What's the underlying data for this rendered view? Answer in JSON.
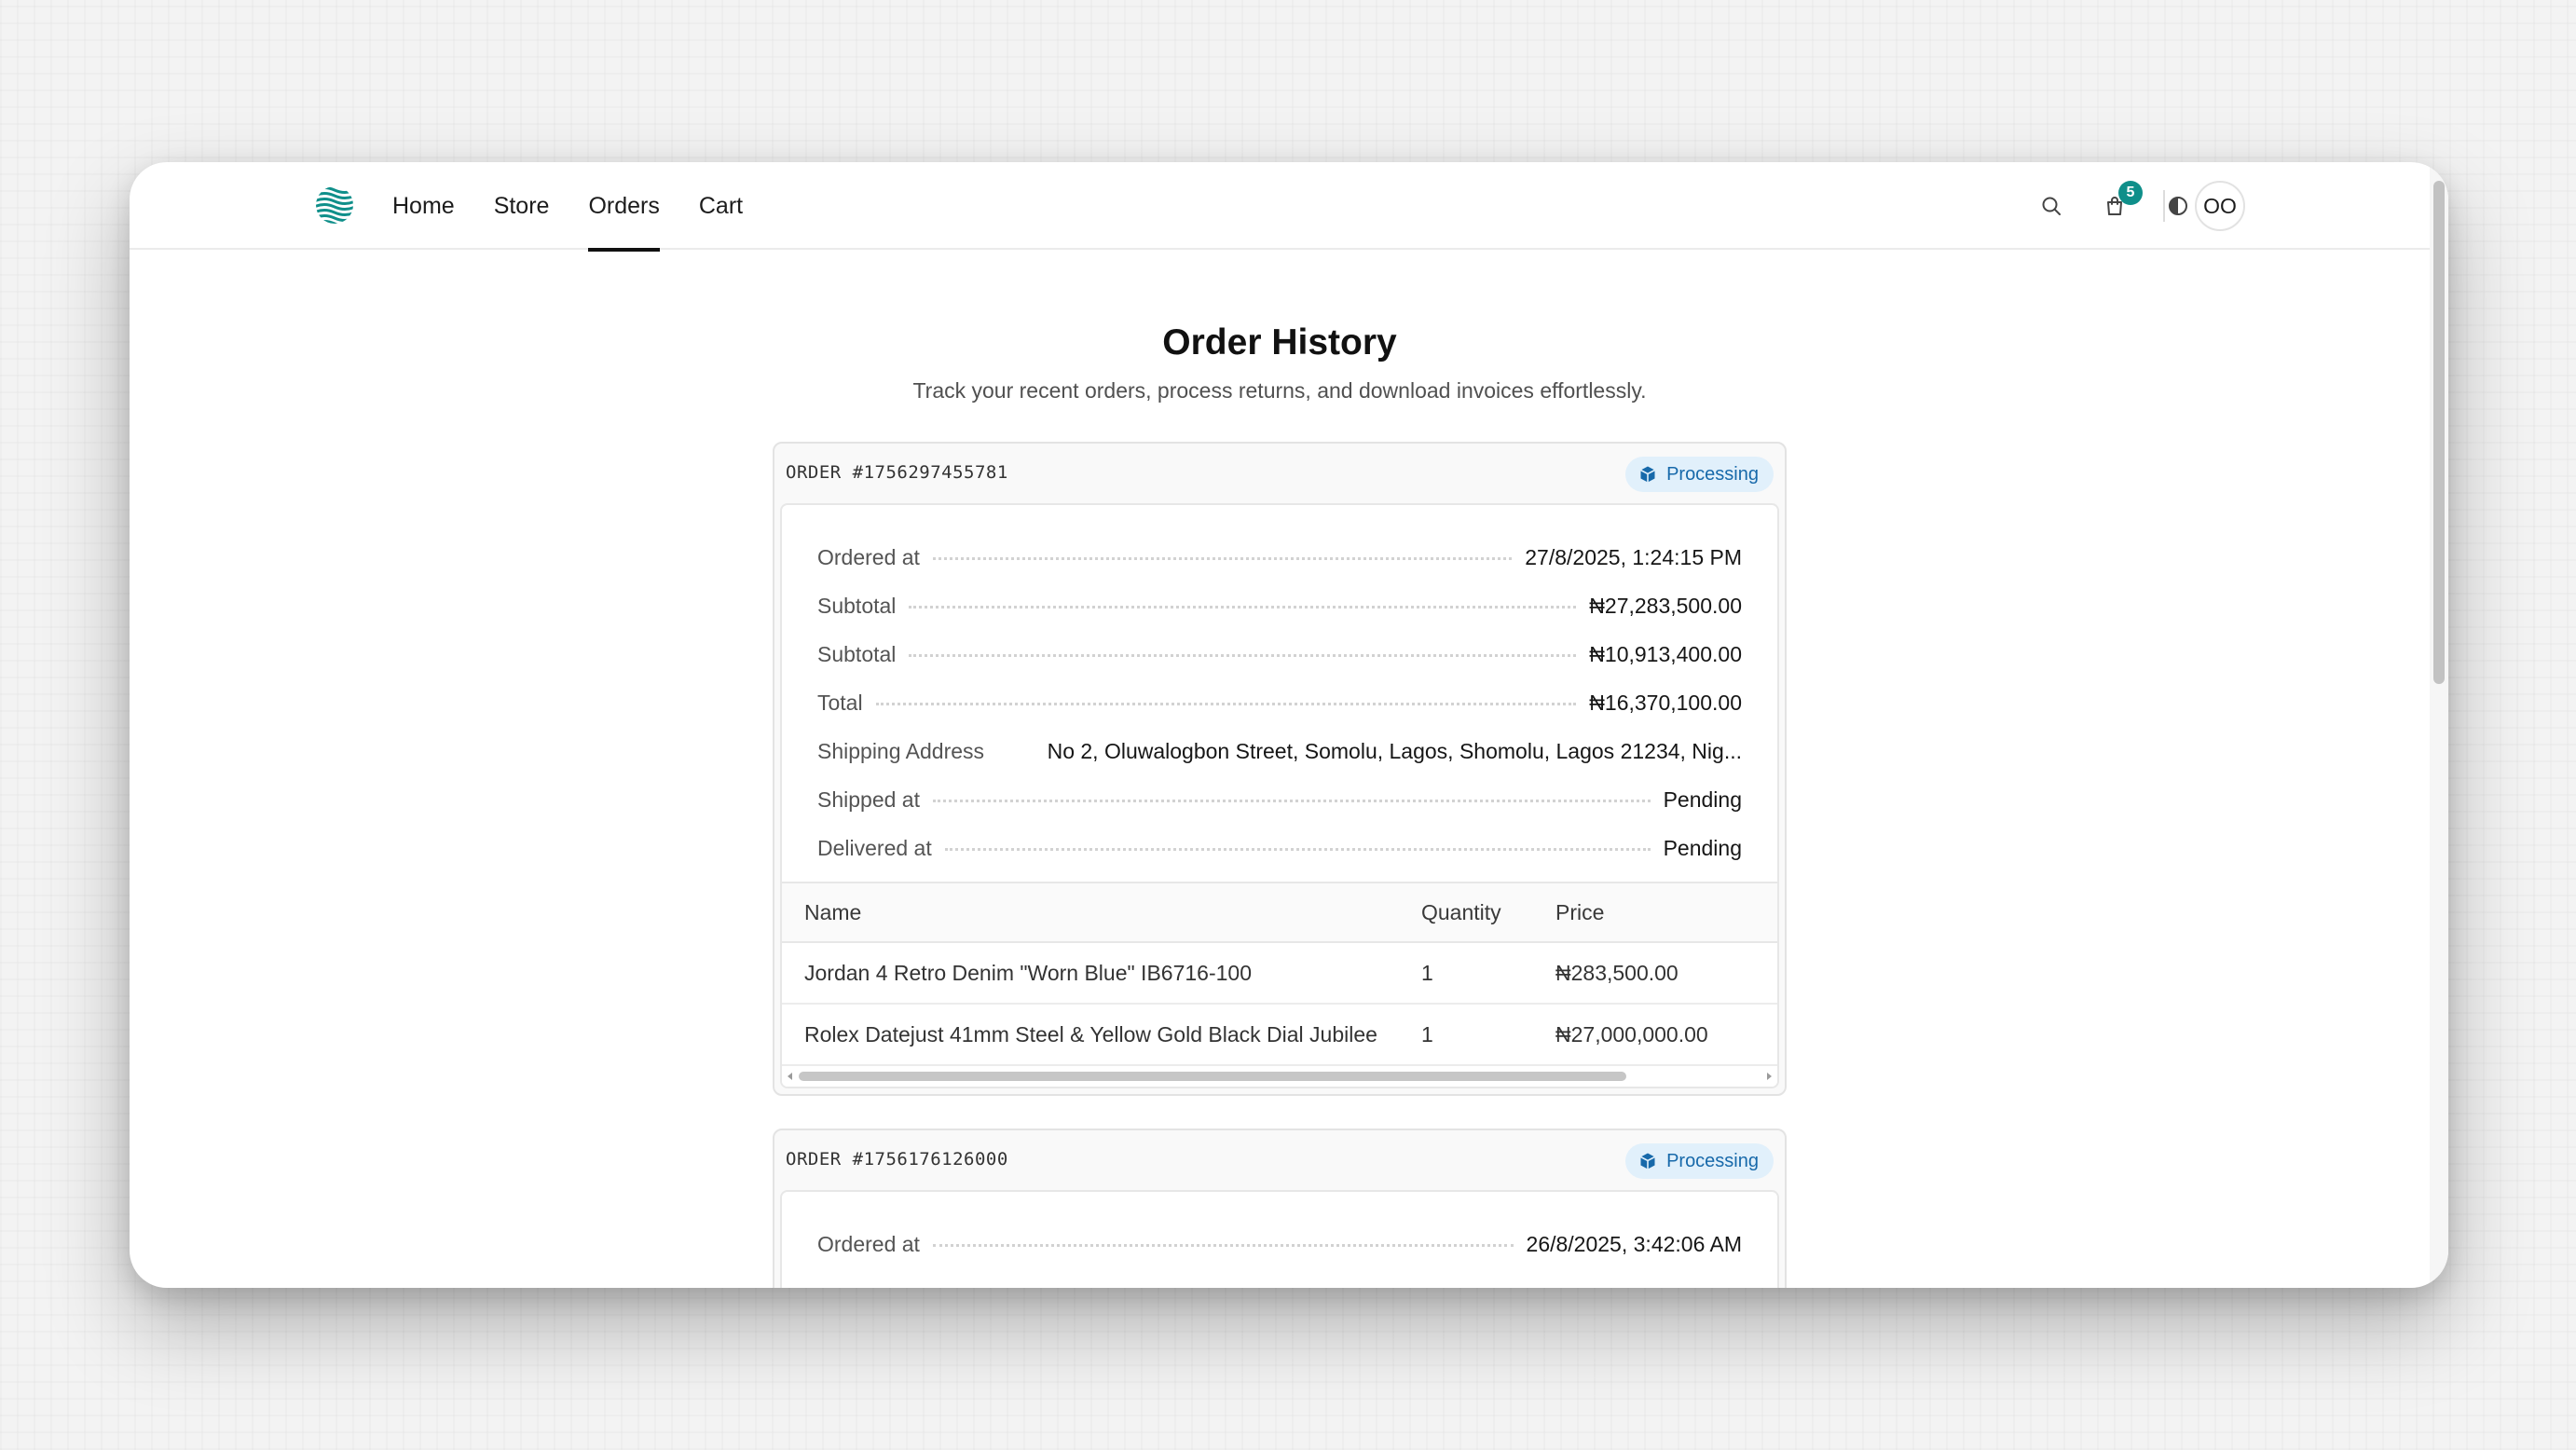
{
  "nav": {
    "links": [
      {
        "label": "Home",
        "active": false
      },
      {
        "label": "Store",
        "active": false
      },
      {
        "label": "Orders",
        "active": true
      },
      {
        "label": "Cart",
        "active": false
      }
    ],
    "cart_count": "5",
    "avatar_initials": "OO",
    "icons": [
      "logo-icon",
      "search-icon",
      "shopping-bag-icon",
      "theme-toggle-icon"
    ]
  },
  "header": {
    "title": "Order History",
    "subtitle": "Track your recent orders, process returns, and download invoices effortlessly."
  },
  "orders": [
    {
      "id": "ORDER #1756297455781",
      "status": "Processing",
      "details": [
        {
          "label": "Ordered at",
          "value": "27/8/2025, 1:24:15 PM"
        },
        {
          "label": "Subtotal",
          "value": "₦27,283,500.00"
        },
        {
          "label": "Subtotal",
          "value": "₦10,913,400.00"
        },
        {
          "label": "Total",
          "value": "₦16,370,100.00"
        },
        {
          "label": "Shipping Address",
          "value": "No 2, Oluwalogbon Street, Somolu, Lagos, Shomolu, Lagos 21234, Nig..."
        },
        {
          "label": "Shipped at",
          "value": "Pending"
        },
        {
          "label": "Delivered at",
          "value": "Pending"
        }
      ],
      "table": {
        "headers": [
          "Name",
          "Quantity",
          "Price"
        ],
        "rows": [
          [
            "Jordan 4 Retro Denim \"Worn Blue\" IB6716-100",
            "1",
            "₦283,500.00"
          ],
          [
            "Rolex Datejust 41mm Steel & Yellow Gold Black Dial Jubilee",
            "1",
            "₦27,000,000.00"
          ]
        ]
      }
    },
    {
      "id": "ORDER #1756176126000",
      "status": "Processing",
      "details": [
        {
          "label": "Ordered at",
          "value": "26/8/2025, 3:42:06 AM"
        }
      ]
    }
  ],
  "colors": {
    "accent": "#0f8f8a",
    "status_bg": "#e1f0fb",
    "status_text": "#1769aa"
  }
}
